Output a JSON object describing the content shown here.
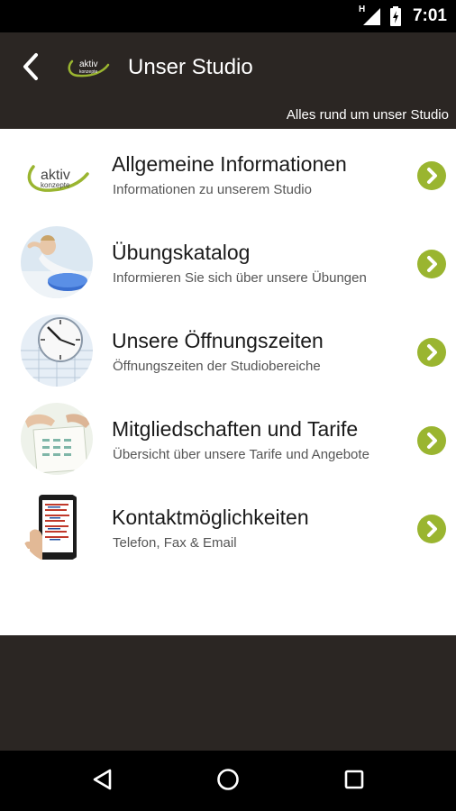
{
  "status_bar": {
    "time": "7:01",
    "network_label": "H",
    "icons": [
      "signal-icon",
      "battery-charging-icon"
    ]
  },
  "app_bar": {
    "title": "Unser Studio",
    "subtitle": "Alles rund um unser Studio",
    "logo_text_top": "aktiv",
    "logo_text_bottom": "konzepte",
    "background_color": "#2b2623"
  },
  "list": {
    "accent_color": "#9ab530",
    "items": [
      {
        "title": "Allgemeine Informationen",
        "subtitle": "Informationen zu unserem Studio",
        "thumb": "aktiv-konzepte-logo",
        "logo_top": "aktiv",
        "logo_bottom": "konzepte"
      },
      {
        "title": "Übungskatalog",
        "subtitle": "Informieren Sie sich über unsere Übungen",
        "thumb": "exercise-photo"
      },
      {
        "title": "Unsere Öffnungszeiten",
        "subtitle": "Öffnungszeiten der Studiobereiche",
        "thumb": "clock-photo"
      },
      {
        "title": "Mitgliedschaften und Tarife",
        "subtitle": "Übersicht über unsere Tarife und Angebote",
        "thumb": "contract-photo"
      },
      {
        "title": "Kontaktmöglichkeiten",
        "subtitle": "Telefon, Fax & Email",
        "thumb": "contact-phone-photo"
      }
    ]
  },
  "nav_bar": {
    "buttons": [
      "back-triangle-icon",
      "home-circle-icon",
      "recents-square-icon"
    ]
  }
}
